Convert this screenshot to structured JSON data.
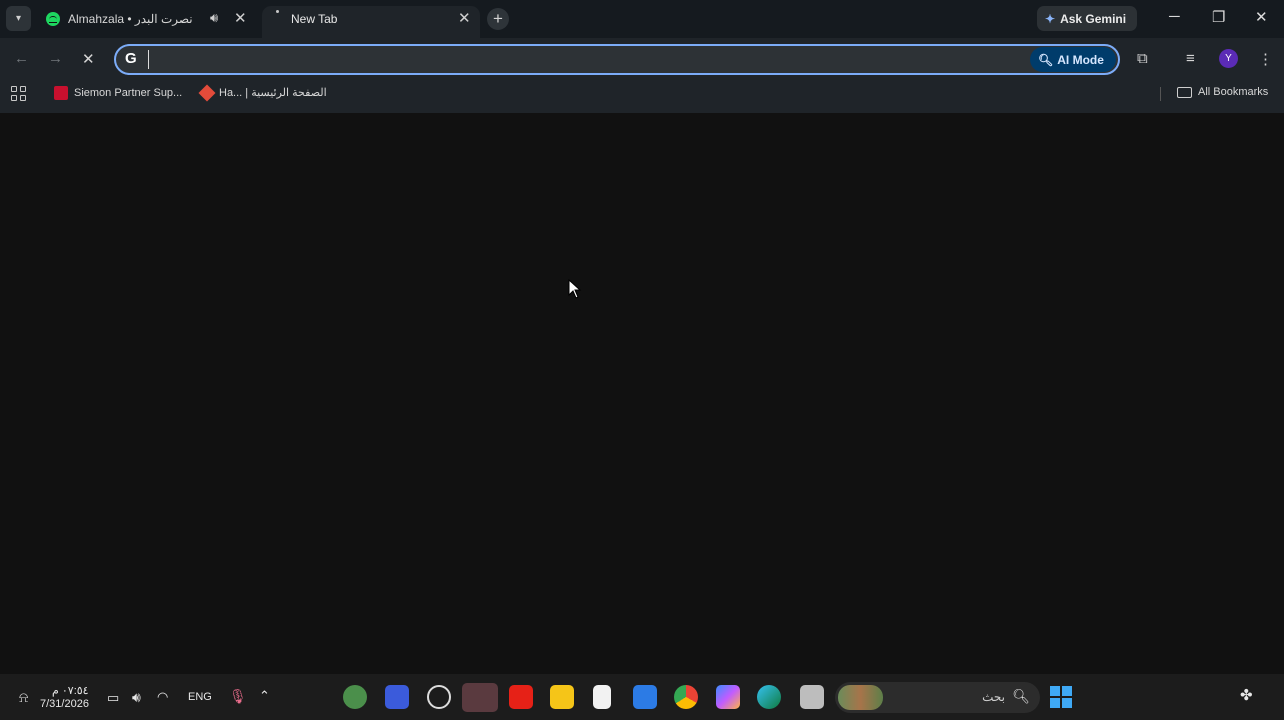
{
  "tabs": [
    {
      "title": "Almahzala • نصرت البدر",
      "playing_audio": true
    },
    {
      "title": "New Tab",
      "active": true
    }
  ],
  "ask_gemini_label": "Ask Gemini",
  "omnibox": {
    "value": "",
    "ai_mode_label": "AI Mode"
  },
  "avatar_initial": "Y",
  "bookmarks": [
    {
      "label": "Siemon Partner Sup..."
    },
    {
      "label": "Ha... | الصفحة الرئيسية"
    }
  ],
  "all_bookmarks_label": "All Bookmarks",
  "taskbar": {
    "time": "٠٧:٥٤ م",
    "date": "7/31/2026",
    "language": "ENG",
    "search_placeholder": "بحث"
  },
  "colors": {
    "accent": "#7cacf8",
    "ai_mode_bg": "#003c6b",
    "page_bg": "#111111"
  }
}
